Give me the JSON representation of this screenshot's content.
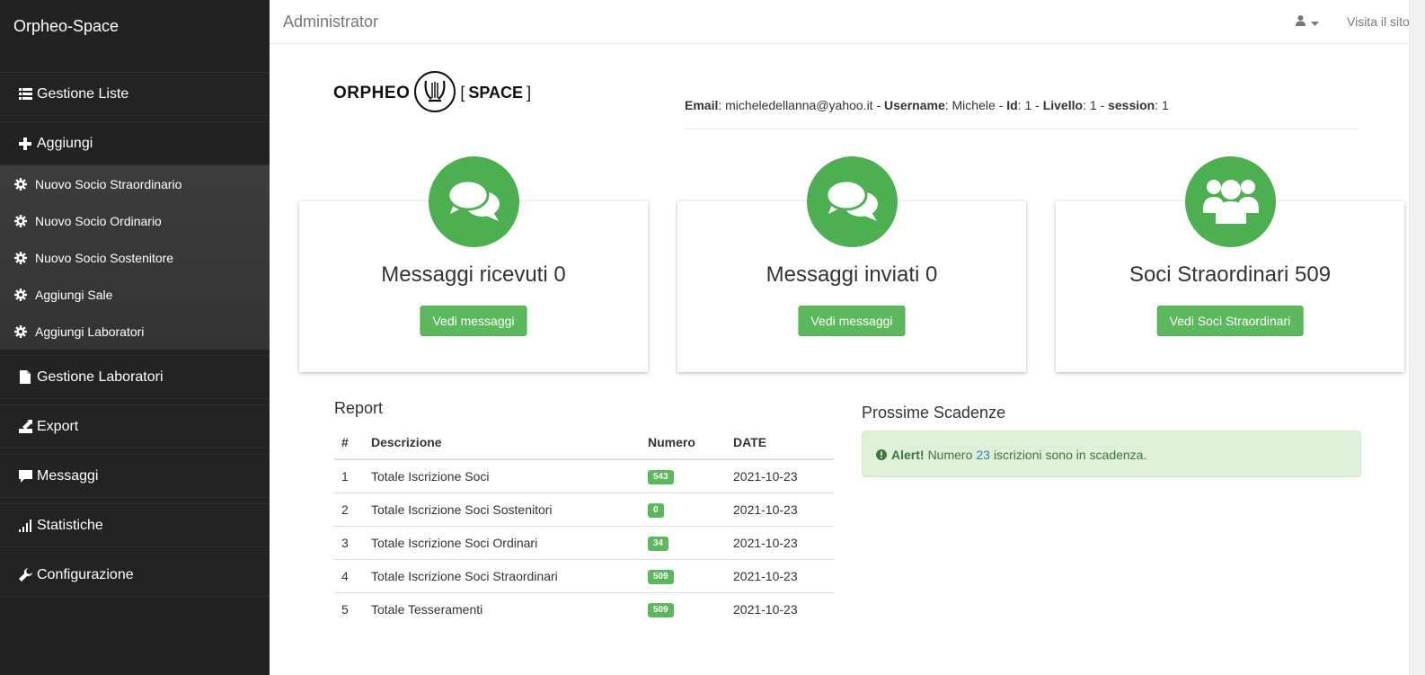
{
  "sidebar": {
    "brand": "Orpheo-Space",
    "items": [
      {
        "label": "Gestione Liste",
        "icon": "list-icon"
      },
      {
        "label": "Aggiungi",
        "icon": "plus-icon"
      },
      {
        "label": "Gestione Laboratori",
        "icon": "file-icon"
      },
      {
        "label": "Export",
        "icon": "export-icon"
      },
      {
        "label": "Messaggi",
        "icon": "comment-icon"
      },
      {
        "label": "Statistiche",
        "icon": "signal-icon"
      },
      {
        "label": "Configurazione",
        "icon": "wrench-icon"
      }
    ],
    "submenu": [
      {
        "label": "Nuovo Socio Straordinario",
        "icon": "cog-icon"
      },
      {
        "label": "Nuovo Socio Ordinario",
        "icon": "cog-icon"
      },
      {
        "label": "Nuovo Socio Sostenitore",
        "icon": "cog-icon"
      },
      {
        "label": "Aggiungi Sale",
        "icon": "cog-icon"
      },
      {
        "label": "Aggiungi Laboratori",
        "icon": "cog-icon"
      }
    ]
  },
  "header": {
    "title": "Administrator",
    "visit_label": "Visita il sito"
  },
  "logo": {
    "word1": "ORPHEO",
    "open_bracket": "[",
    "word2": "SPACE",
    "close_bracket": "]"
  },
  "userinfo": {
    "email_label": "Email",
    "email": "micheledellanna@yahoo.it",
    "username_label": "Username",
    "username": "Michele",
    "id_label": "Id",
    "id": "1",
    "level_label": "Livello",
    "level": "1",
    "session_label": "session",
    "session": "1"
  },
  "cards": [
    {
      "title": "Messaggi ricevuti 0",
      "button": "Vedi messaggi",
      "icon": "comments-icon"
    },
    {
      "title": "Messaggi inviati 0",
      "button": "Vedi messaggi",
      "icon": "comments-icon"
    },
    {
      "title": "Soci Straordinari 509",
      "button": "Vedi Soci Straordinari",
      "icon": "users-icon"
    }
  ],
  "report": {
    "title": "Report",
    "columns": [
      "#",
      "Descrizione",
      "Numero",
      "DATE"
    ],
    "rows": [
      {
        "n": "1",
        "desc": "Totale Iscrizione Soci",
        "num": "543",
        "date": "2021-10-23"
      },
      {
        "n": "2",
        "desc": "Totale Iscrizione Soci Sostenitori",
        "num": "0",
        "date": "2021-10-23"
      },
      {
        "n": "3",
        "desc": "Totale Iscrizione Soci Ordinari",
        "num": "34",
        "date": "2021-10-23"
      },
      {
        "n": "4",
        "desc": "Totale Iscrizione Soci Straordinari",
        "num": "509",
        "date": "2021-10-23"
      },
      {
        "n": "5",
        "desc": "Totale Tesseramenti",
        "num": "509",
        "date": "2021-10-23"
      }
    ]
  },
  "deadlines": {
    "title": "Prossime Scadenze",
    "alert_strong": "Alert!",
    "alert_pre": "Numero",
    "alert_number": "23",
    "alert_post": "iscrizioni sono in scadenza."
  },
  "colors": {
    "sidebar_bg": "#222222",
    "accent_green": "#4caf50",
    "button_green": "#5cb85c",
    "alert_bg": "#dff0d8",
    "alert_text": "#3c763d",
    "link_blue": "#337ab7"
  }
}
